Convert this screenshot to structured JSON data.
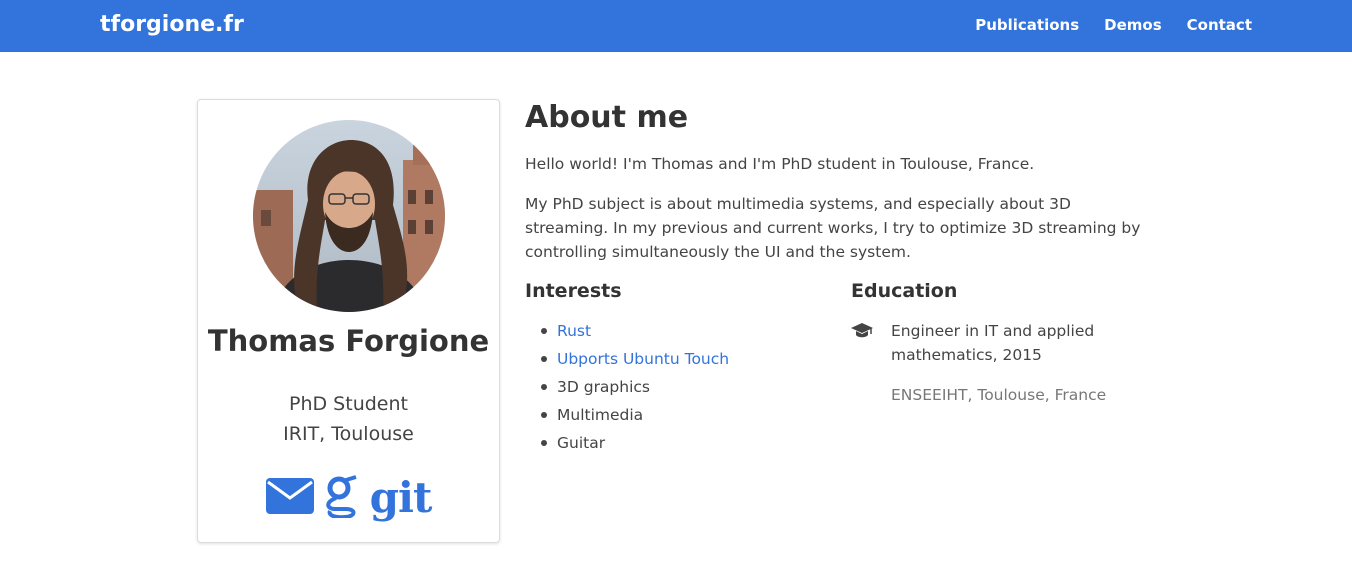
{
  "navbar": {
    "brand": "tforgione.fr",
    "links": [
      {
        "label": "Publications"
      },
      {
        "label": "Demos"
      },
      {
        "label": "Contact"
      }
    ]
  },
  "profile": {
    "name": "Thomas Forgione",
    "role": "PhD Student",
    "place": "IRIT, Toulouse",
    "social": [
      {
        "icon": "envelope-icon"
      },
      {
        "icon": "google-scholar-icon"
      },
      {
        "icon": "git-icon",
        "label": "git"
      }
    ]
  },
  "about": {
    "title": "About me",
    "paragraphs": [
      "Hello world! I'm Thomas and I'm PhD student in Toulouse, France.",
      "My PhD subject is about multimedia systems, and especially about 3D streaming. In my previous and current works, I try to optimize 3D streaming by controlling simultaneously the UI and the system."
    ]
  },
  "interests": {
    "title": "Interests",
    "items": [
      {
        "label": "Rust"
      },
      {
        "label": "Ubports Ubuntu Touch"
      },
      {
        "label": "3D graphics"
      },
      {
        "label": "Multimedia"
      },
      {
        "label": "Guitar"
      }
    ]
  },
  "education": {
    "title": "Education",
    "entries": [
      {
        "icon": "graduation-cap-icon",
        "degree": "Engineer in IT and applied mathematics, 2015",
        "school": "ENSEEIHT, Toulouse, France"
      }
    ]
  },
  "colors": {
    "primary": "#3273dc",
    "text": "#444444",
    "muted": "#777777"
  }
}
